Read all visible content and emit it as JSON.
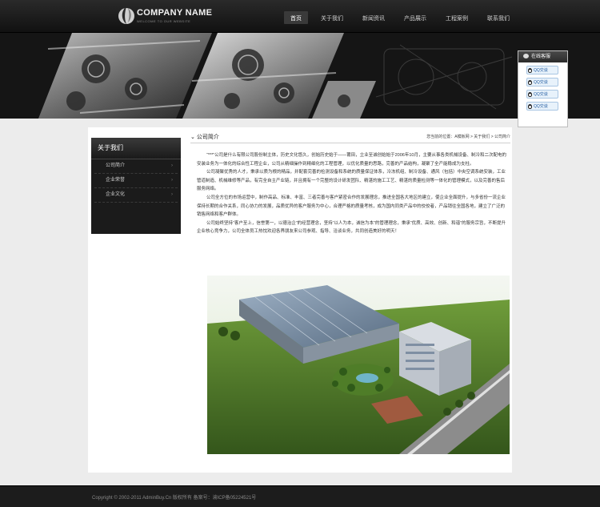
{
  "header": {
    "company_name": "COMPANY NAME",
    "tagline": "WELCOME TO OUR WEBSITE",
    "nav": [
      "首页",
      "关于我们",
      "新闻资讯",
      "产品展示",
      "工程案例",
      "联系我们"
    ]
  },
  "service": {
    "title": "在线客服",
    "buttons": [
      "QQ交谈",
      "QQ交谈",
      "QQ交谈",
      "QQ交谈"
    ]
  },
  "sidebar": {
    "title": "关于我们",
    "items": [
      "公司简介",
      "企业荣誉",
      "企业文化"
    ]
  },
  "main": {
    "section_title": "公司简介",
    "breadcrumb": "您当前的位置：A模板网 > 关于我们 > 公司简介",
    "paragraphs": [
      "“***”公司是什么有限公司股份制主体，历史文化悠久，创始历史始于——莆田，立业至诚创始始于2006年10月，主要从事各类机械设备、制冷和二次配电的安装业务为一体化的综合性工程企业，公司从精细操作到精细化的工程管理，以优化质量的思路，完善的产品结构，凝聚了全产能稳成为支柱。",
      "公司凝聚优秀的人才，秉承以质为根的精品，并配套完善的检测设备和系统的质量保证体系，冷冻机组、制冷设备、通风（包括）中央空调系统安装，工业管道制造、机械维修等产品，有完全自主产业链，并且拥有一个完整的设计研发团队、精湛的施工工艺、精湛的质量检测等一体化的管理模式，以及完善的售后服务网络。",
      "公司全方位的市场运营中，制作高品、标准、丰富、三者完善与客户紧密合作的发展理念，推进全国各大地区的建立，使企业全面提升，与多省份一流企业保持长期的合作关系，同心协力的发展，品质优异的客户服务为中心，合理严格的质量考核，成为国内同类产品中的佼佼者，产品销往全国各地，建立了广泛的销售网络和客户群体。",
      "公司始终坚持“客户至上，信誉第一，以德治企”的经营理念，坚持“以人为本，诚信为本”的管理理念，秉承“优质、高效、创新、和谐”的服务宗旨，不断提升企业核心竞争力，公司全体员工热忱欢迎各界朋友来公司参观、指导、洽谈业务，共同创造美好的明天！"
    ]
  },
  "footer": {
    "text": "Copyright © 2002-2011 AdminBuy.Cn 版权所有 备案号：渝ICP备05224521号"
  }
}
